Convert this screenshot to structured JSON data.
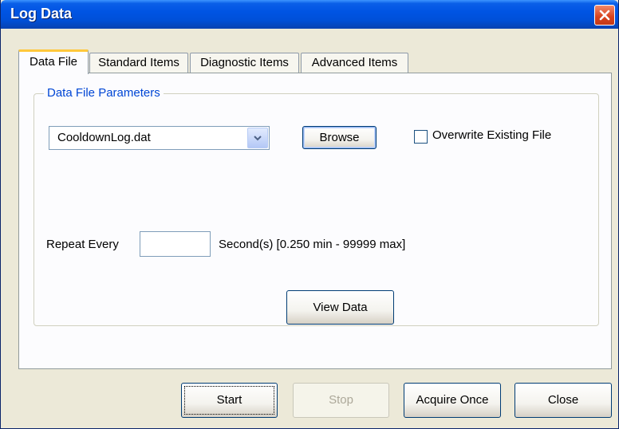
{
  "window": {
    "title": "Log Data",
    "close_icon": "close-icon"
  },
  "tabs": [
    {
      "label": "Data File",
      "active": true
    },
    {
      "label": "Standard Items",
      "active": false
    },
    {
      "label": "Diagnostic Items",
      "active": false
    },
    {
      "label": "Advanced Items",
      "active": false
    }
  ],
  "data_file": {
    "group_label": "Data File Parameters",
    "file_name": "CooldownLog.dat",
    "dropdown_icon": "chevron-down-icon",
    "browse_label": "Browse",
    "overwrite_label": "Overwrite Existing File",
    "overwrite_checked": false,
    "repeat_label": "Repeat Every",
    "repeat_value": "",
    "range_label": "Second(s) [0.250 min - 99999 max]",
    "view_data_label": "View Data"
  },
  "footer": {
    "start_label": "Start",
    "stop_label": "Stop",
    "acquire_once_label": "Acquire Once",
    "close_label": "Close"
  },
  "colors": {
    "titlebar": "#0054e3",
    "dialog_bg": "#ece9d8",
    "group_label": "#0046d5",
    "active_tab_accent": "#ffc83c",
    "close_button": "#d8421c"
  }
}
